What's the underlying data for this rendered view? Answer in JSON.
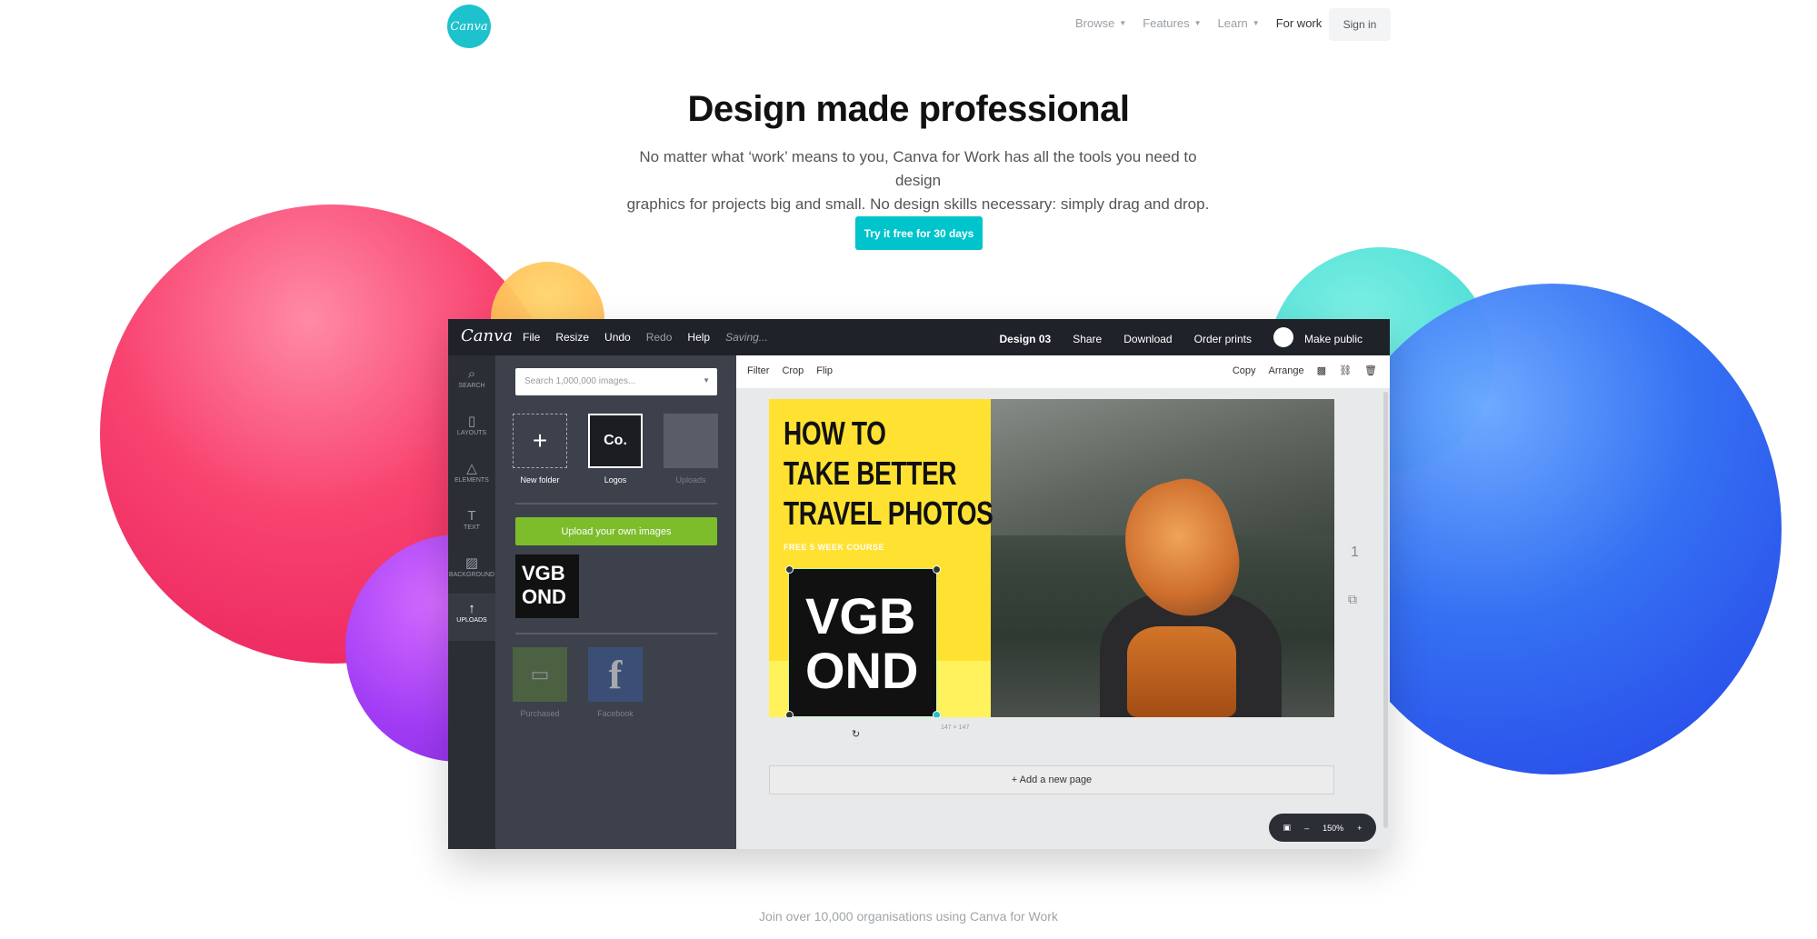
{
  "nav": {
    "logo_text": "Canva",
    "items": [
      {
        "label": "Browse"
      },
      {
        "label": "Features"
      },
      {
        "label": "Learn"
      }
    ],
    "for_work": "For work",
    "sign_in": "Sign in"
  },
  "hero": {
    "title": "Design made professional",
    "subtitle_line1": "No matter what ‘work’ means to you, Canva for Work has all the tools you need to design",
    "subtitle_line2": "graphics for projects big and small. No design skills necessary: simply drag and drop.",
    "cta": "Try it free for 30 days"
  },
  "editor": {
    "brand": "Canva",
    "menu": {
      "file": "File",
      "resize": "Resize",
      "undo": "Undo",
      "redo": "Redo",
      "help": "Help",
      "saving": "Saving..."
    },
    "right": {
      "design_title": "Design 03",
      "share": "Share",
      "download": "Download",
      "order_prints": "Order prints",
      "make_public": "Make public"
    },
    "rail": [
      {
        "label": "SEARCH",
        "icon": "search-icon"
      },
      {
        "label": "LAYOUTS",
        "icon": "layouts-icon"
      },
      {
        "label": "ELEMENTS",
        "icon": "elements-icon"
      },
      {
        "label": "TEXT",
        "icon": "text-icon"
      },
      {
        "label": "BACKGROUND",
        "icon": "background-icon"
      },
      {
        "label": "UPLOADS",
        "icon": "upload-icon"
      }
    ],
    "panel": {
      "search_placeholder": "Search 1,000,000 images...",
      "folders": {
        "new_folder": "New folder",
        "logos": "Logos",
        "logos_thumb": "Co.",
        "uploads": "Uploads"
      },
      "upload_button": "Upload your own images",
      "thumb_line1": "VGB",
      "thumb_line2": "OND",
      "sources": {
        "purchased": "Purchased",
        "facebook": "Facebook"
      }
    },
    "toolbar": {
      "filter": "Filter",
      "crop": "Crop",
      "flip": "Flip",
      "copy": "Copy",
      "arrange": "Arrange"
    },
    "design": {
      "headline_line1": "HOW TO",
      "headline_line2": "TAKE BETTER",
      "headline_line3": "TRAVEL PHOTOS",
      "course": "FREE 5 WEEK COURSE",
      "logo_line1": "VGB",
      "logo_line2": "OND",
      "size_label": "147 × 147"
    },
    "page_number": "1",
    "add_page": "+ Add a new page",
    "zoom": {
      "minus": "–",
      "value": "150%",
      "plus": "+"
    }
  },
  "footer": {
    "text": "Join over 10,000 organisations using Canva for Work"
  },
  "colors": {
    "accent": "#00c4cc",
    "upload_green": "#7dbd2c",
    "editor_dark": "#1f2229"
  }
}
